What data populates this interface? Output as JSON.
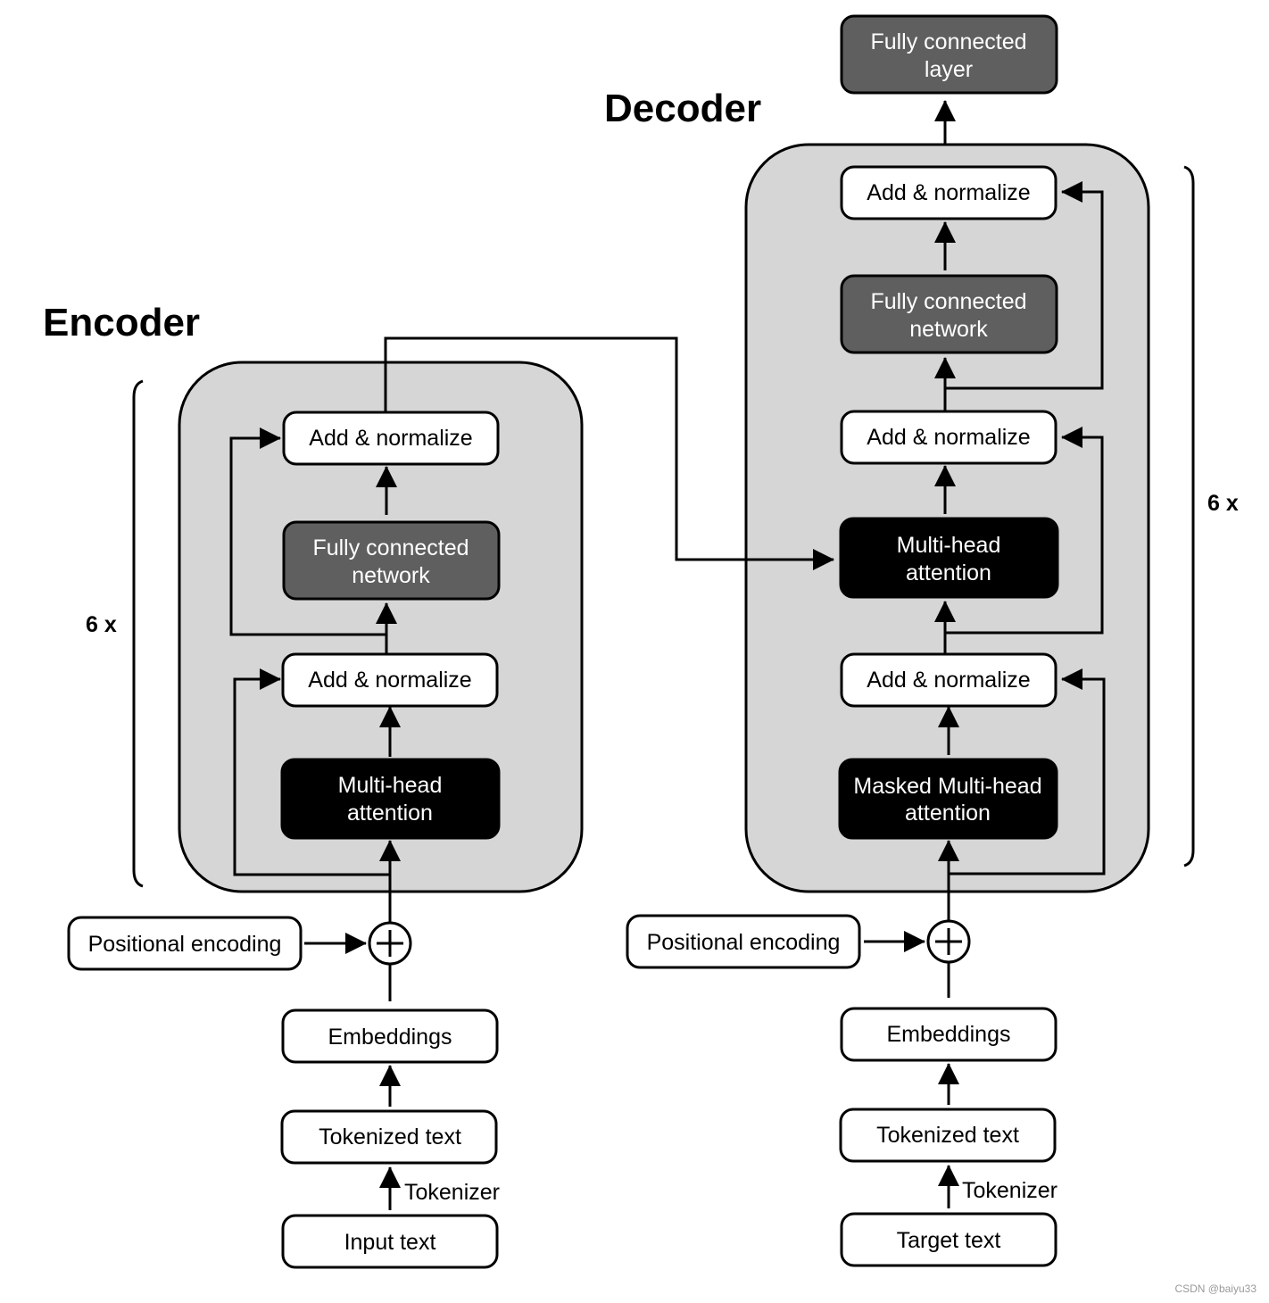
{
  "colors": {
    "block_fill": "#d6d6d6",
    "white_node": "#ffffff",
    "gray_node": "#5f5f5f",
    "black_node": "#000000",
    "stroke": "#000000",
    "watermark": "#9a9a9a"
  },
  "encoder": {
    "title": "Encoder",
    "repeat_label": "6 x",
    "nodes": {
      "add_norm_top": "Add & normalize",
      "ffn": [
        "Fully connected",
        "network"
      ],
      "add_norm_bottom": "Add & normalize",
      "attention": [
        "Multi-head",
        "attention"
      ],
      "positional_encoding": "Positional encoding",
      "embeddings": "Embeddings",
      "tokenized_text": "Tokenized text",
      "tokenizer_label": "Tokenizer",
      "input_text": "Input text"
    }
  },
  "decoder": {
    "title": "Decoder",
    "repeat_label": "6 x",
    "nodes": {
      "output_layer": [
        "Fully connected",
        "layer"
      ],
      "add_norm_top": "Add & normalize",
      "ffn": [
        "Fully connected",
        "network"
      ],
      "add_norm_middle": "Add & normalize",
      "cross_attention": [
        "Multi-head",
        "attention"
      ],
      "add_norm_bottom": "Add & normalize",
      "masked_attention": [
        "Masked Multi-head",
        "attention"
      ],
      "positional_encoding": "Positional encoding",
      "embeddings": "Embeddings",
      "tokenized_text": "Tokenized text",
      "tokenizer_label": "Tokenizer",
      "target_text": "Target text"
    }
  },
  "watermark": "CSDN @baiyu33"
}
